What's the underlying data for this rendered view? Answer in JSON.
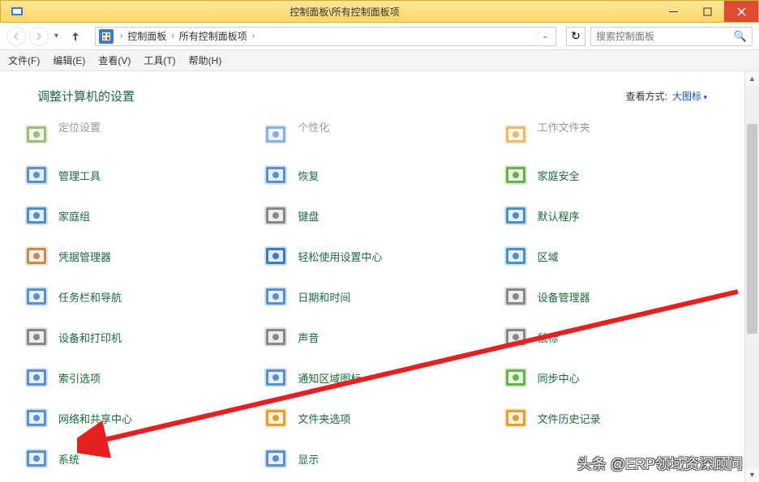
{
  "window": {
    "title": "控制面板\\所有控制面板项",
    "minimize": "最小化",
    "maximize": "最大化",
    "close": "关闭"
  },
  "breadcrumb": {
    "seg1": "控制面板",
    "seg2": "所有控制面板项"
  },
  "search": {
    "placeholder": "搜索控制面板"
  },
  "menu": {
    "file": "文件(F)",
    "edit": "编辑(E)",
    "view": "查看(V)",
    "tools": "工具(T)",
    "help": "帮助(H)"
  },
  "header": {
    "title": "调整计算机的设置",
    "view_label": "查看方式:",
    "view_mode": "大图标"
  },
  "items": [
    {
      "label": "定位设置",
      "name": "location-settings",
      "cut": true
    },
    {
      "label": "个性化",
      "name": "personalization",
      "cut": true
    },
    {
      "label": "工作文件夹",
      "name": "work-folders",
      "cut": true
    },
    {
      "label": "管理工具",
      "name": "admin-tools"
    },
    {
      "label": "恢复",
      "name": "recovery"
    },
    {
      "label": "家庭安全",
      "name": "family-safety"
    },
    {
      "label": "家庭组",
      "name": "homegroup"
    },
    {
      "label": "键盘",
      "name": "keyboard"
    },
    {
      "label": "默认程序",
      "name": "default-programs"
    },
    {
      "label": "凭据管理器",
      "name": "credential-manager"
    },
    {
      "label": "轻松使用设置中心",
      "name": "ease-of-access"
    },
    {
      "label": "区域",
      "name": "region"
    },
    {
      "label": "任务栏和导航",
      "name": "taskbar-navigation"
    },
    {
      "label": "日期和时间",
      "name": "date-time"
    },
    {
      "label": "设备管理器",
      "name": "device-manager"
    },
    {
      "label": "设备和打印机",
      "name": "devices-printers"
    },
    {
      "label": "声音",
      "name": "sound"
    },
    {
      "label": "鼠标",
      "name": "mouse"
    },
    {
      "label": "索引选项",
      "name": "indexing-options"
    },
    {
      "label": "通知区域图标",
      "name": "notification-area"
    },
    {
      "label": "同步中心",
      "name": "sync-center"
    },
    {
      "label": "网络和共享中心",
      "name": "network-sharing"
    },
    {
      "label": "文件夹选项",
      "name": "folder-options"
    },
    {
      "label": "文件历史记录",
      "name": "file-history"
    },
    {
      "label": "系统",
      "name": "system"
    },
    {
      "label": "显示",
      "name": "display"
    }
  ],
  "icon_colors": [
    "#7a9e4a",
    "#5a8fd0",
    "#e0a030",
    "#5a8fd0",
    "#5a8fd0",
    "#6ab04c",
    "#4a90c0",
    "#888888",
    "#4a90c0",
    "#c09050",
    "#3a7bc2",
    "#4a90c0",
    "#5a8fd0",
    "#5a8fd0",
    "#888888",
    "#888888",
    "#888888",
    "#888888",
    "#5a8fd0",
    "#5a8fd0",
    "#6ab04c",
    "#5a8fd0",
    "#e0a030",
    "#e0a030",
    "#5a8fd0",
    "#5a8fd0"
  ],
  "watermark": "头条 @ERP领域资深顾问"
}
